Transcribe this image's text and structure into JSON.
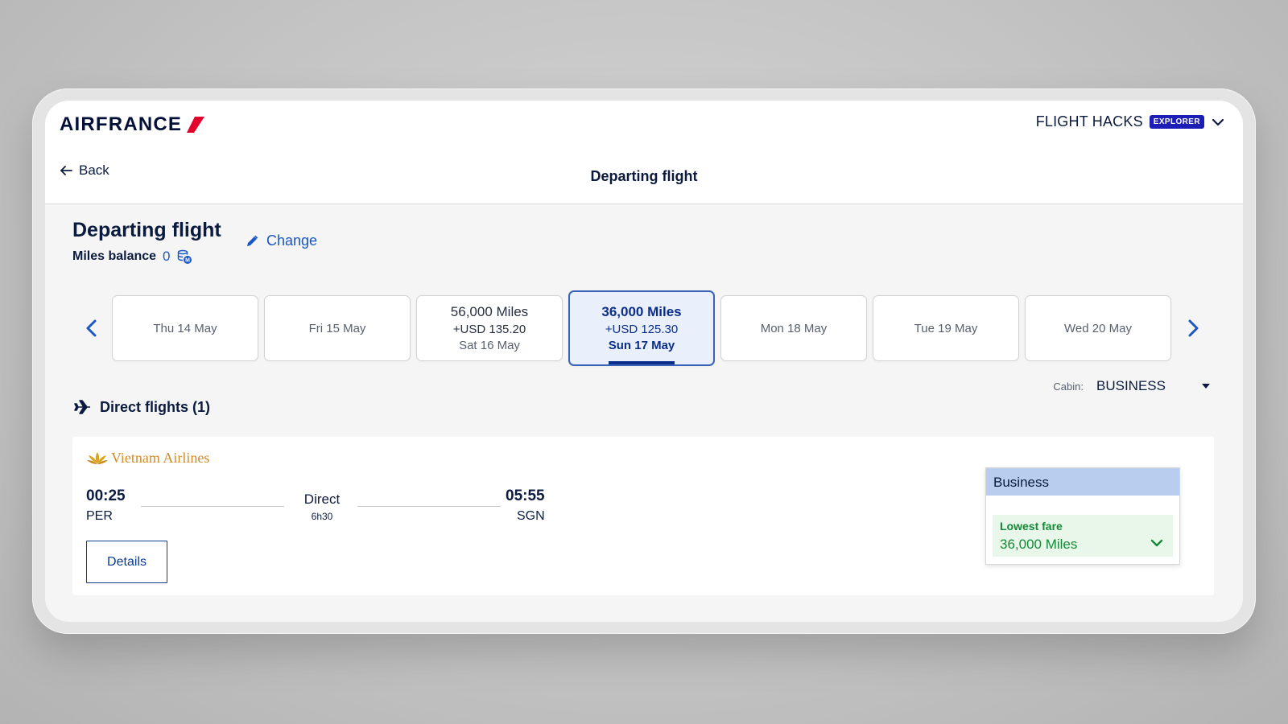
{
  "brand": {
    "logo_text": "AIRFRANCE",
    "accent_color": "#e4002b",
    "navy": "#051039"
  },
  "account": {
    "name": "FLIGHT HACKS",
    "badge": "EXPLORER"
  },
  "nav": {
    "back_label": "Back",
    "title": "Departing flight"
  },
  "header": {
    "title": "Departing flight",
    "change_label": "Change",
    "miles_label": "Miles balance",
    "miles_value": "0"
  },
  "dates": [
    {
      "label": "Thu 14 May",
      "miles": "",
      "usd": ""
    },
    {
      "label": "Fri 15 May",
      "miles": "",
      "usd": ""
    },
    {
      "label": "Sat 16 May",
      "miles": "56,000 Miles",
      "usd": "+USD 135.20"
    },
    {
      "label": "Sun 17 May",
      "miles": "36,000 Miles",
      "usd": "+USD 125.30",
      "selected": true
    },
    {
      "label": "Mon 18 May",
      "miles": "",
      "usd": ""
    },
    {
      "label": "Tue 19 May",
      "miles": "",
      "usd": ""
    },
    {
      "label": "Wed 20 May",
      "miles": "",
      "usd": ""
    }
  ],
  "cabin": {
    "label": "Cabin:",
    "value": "BUSINESS"
  },
  "section": {
    "title": "Direct flights (1)"
  },
  "flight": {
    "airline": "Vietnam Airlines",
    "dep_time": "00:25",
    "dep_airport": "PER",
    "route_type": "Direct",
    "duration": "6h30",
    "arr_time": "05:55",
    "arr_airport": "SGN",
    "details_label": "Details",
    "fare": {
      "cabin": "Business",
      "lowest_label": "Lowest fare",
      "lowest_value": "36,000 Miles"
    }
  }
}
